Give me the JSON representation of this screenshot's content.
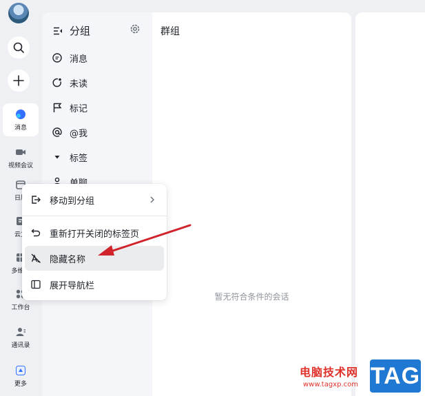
{
  "rail": {
    "items": [
      {
        "label": "消息",
        "icon": "message-bubble-icon",
        "active": true
      },
      {
        "label": "视频会议",
        "icon": "video-camera-icon"
      },
      {
        "label": "日历",
        "icon": "calendar-icon"
      },
      {
        "label": "云文",
        "icon": "cloud-doc-icon"
      },
      {
        "label": "多维表",
        "icon": "table-icon"
      },
      {
        "label": "工作台",
        "icon": "workspace-grid-icon"
      },
      {
        "label": "通讯录",
        "icon": "contacts-icon"
      },
      {
        "label": "更多",
        "icon": "more-apps-icon"
      }
    ]
  },
  "groups_panel": {
    "title": "分组",
    "items": [
      {
        "label": "消息",
        "icon": "chat-bubble-icon"
      },
      {
        "label": "未读",
        "icon": "unread-icon"
      },
      {
        "label": "标记",
        "icon": "flag-icon"
      },
      {
        "label": "@我",
        "icon": "at-sign-icon"
      },
      {
        "label": "标签",
        "icon": "caret-down-icon"
      },
      {
        "label": "单聊",
        "icon": "person-icon"
      }
    ]
  },
  "list_panel": {
    "title": "群组",
    "empty_text": "暂无符合条件的会话"
  },
  "context_menu": {
    "items": [
      {
        "label": "移动到分组",
        "icon": "move-to-group-icon",
        "has_submenu": true
      },
      {
        "label": "重新打开关闭的标签页",
        "icon": "undo-icon"
      },
      {
        "label": "隐藏名称",
        "icon": "hide-name-icon",
        "highlighted": true
      },
      {
        "label": "展开导航栏",
        "icon": "sidebar-expand-icon"
      }
    ]
  },
  "watermark": {
    "site_name": "电脑技术网",
    "url": "www.tagxp.com",
    "tag": "TAG"
  },
  "colors": {
    "accent_blue": "#3370ff",
    "annotation_red": "#d0232b",
    "watermark_red": "#e0322a",
    "tag_blue": "#1f78d1"
  }
}
